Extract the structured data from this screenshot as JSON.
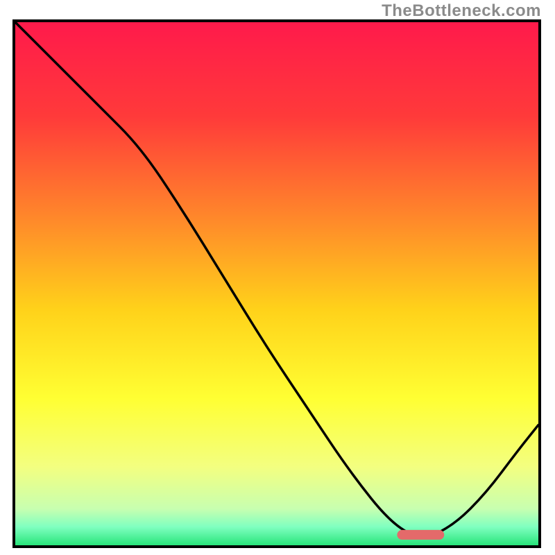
{
  "watermark": "TheBottleneck.com",
  "chart_data": {
    "type": "line",
    "title": "",
    "xlabel": "",
    "ylabel": "",
    "xlim": [
      0,
      100
    ],
    "ylim": [
      0,
      100
    ],
    "grid": false,
    "background": {
      "type": "vertical-gradient",
      "stops": [
        {
          "pos": 0.0,
          "color": "#ff1a4b"
        },
        {
          "pos": 0.18,
          "color": "#ff3a3a"
        },
        {
          "pos": 0.38,
          "color": "#ff8a2a"
        },
        {
          "pos": 0.55,
          "color": "#ffd21a"
        },
        {
          "pos": 0.72,
          "color": "#ffff33"
        },
        {
          "pos": 0.85,
          "color": "#f3ff80"
        },
        {
          "pos": 0.93,
          "color": "#c8ffb0"
        },
        {
          "pos": 0.965,
          "color": "#7fffc0"
        },
        {
          "pos": 1.0,
          "color": "#28e57a"
        }
      ]
    },
    "series": [
      {
        "name": "bottleneck-curve",
        "x": [
          0,
          8,
          16,
          24,
          32,
          40,
          48,
          56,
          64,
          72,
          78,
          84,
          90,
          96,
          100
        ],
        "y": [
          100,
          92,
          84,
          76,
          64,
          51,
          38,
          26,
          14,
          4,
          1,
          4,
          10,
          18,
          23
        ]
      }
    ],
    "markers": [
      {
        "name": "optimal-region",
        "shape": "rounded-rect",
        "x_start": 73,
        "x_end": 82,
        "y": 2,
        "color": "#e46a6a"
      }
    ]
  }
}
